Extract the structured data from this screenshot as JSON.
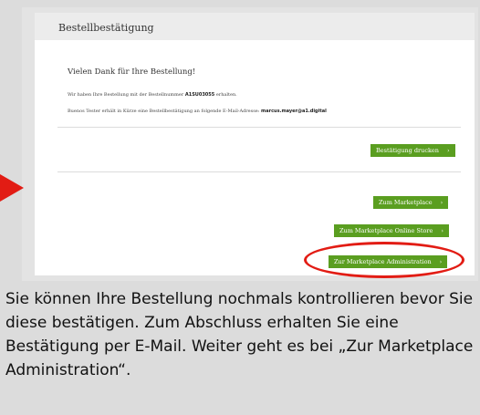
{
  "page": {
    "title": "Bestellbestätigung"
  },
  "content": {
    "thanks": "Vielen Dank für Ihre Bestellung!",
    "order_line_prefix": "Wir haben Ihre Bestellung mit der Bestellnummer",
    "order_number": "A1SU03055",
    "order_line_suffix": "erhalten.",
    "email_line_prefix": "Buenos Tester erhält in Kürze eine Bestellbestätigung an folgende E-Mail-Adresse:",
    "email": "marcus.mayer@a1.digital"
  },
  "buttons": {
    "print_confirmation": "Bestätigung drucken",
    "marketplace": "Zum Marketplace",
    "online_store": "Zum Marketplace Online Store",
    "administration": "Zur Marketplace Administration",
    "chevron": "›"
  },
  "annotation": {
    "arrow_color": "#e21c14",
    "highlight_color": "#e21c14",
    "button_color": "#5a9e20"
  },
  "caption": "Sie können Ihre Bestellung nochmals kontrollieren bevor Sie diese bestätigen. Zum Abschluss erhalten Sie eine Bestätigung per E-Mail. Weiter geht es bei „Zur Marketplace Administration“."
}
